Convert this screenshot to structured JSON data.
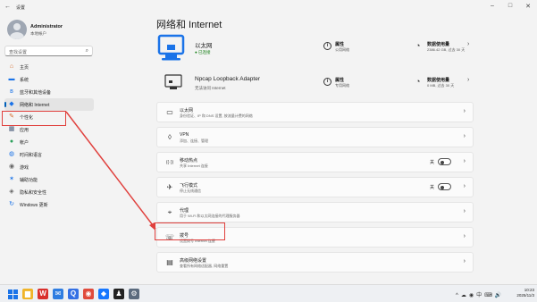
{
  "window": {
    "title": "设置",
    "back": "←",
    "minimize": "–",
    "maximize": "□",
    "close": "✕"
  },
  "profile": {
    "name": "Administrator",
    "account": "本地帐户"
  },
  "search": {
    "placeholder": "查找设置"
  },
  "nav": {
    "items": [
      {
        "label": "主页",
        "icon": "home-icon",
        "glyph": "⌂",
        "color": "#d46a2a"
      },
      {
        "label": "系统",
        "icon": "system-icon",
        "glyph": "▬",
        "color": "#1a73e8"
      },
      {
        "label": "蓝牙和其他设备",
        "icon": "bluetooth-icon",
        "glyph": "ʙ",
        "color": "#1a73e8"
      },
      {
        "label": "网络和 Internet",
        "icon": "wifi-icon",
        "glyph": "◆",
        "color": "#1a73e8"
      },
      {
        "label": "个性化",
        "icon": "brush-icon",
        "glyph": "✎",
        "color": "#d46a2a"
      },
      {
        "label": "应用",
        "icon": "apps-icon",
        "glyph": "▦",
        "color": "#4a5b7a"
      },
      {
        "label": "帐户",
        "icon": "account-icon",
        "glyph": "●",
        "color": "#2aa05a"
      },
      {
        "label": "时间和语言",
        "icon": "globe-icon",
        "glyph": "◍",
        "color": "#1a73e8"
      },
      {
        "label": "游戏",
        "icon": "gamepad-icon",
        "glyph": "◉",
        "color": "#666"
      },
      {
        "label": "辅助功能",
        "icon": "accessibility-icon",
        "glyph": "✶",
        "color": "#1a73e8"
      },
      {
        "label": "隐私和安全性",
        "icon": "shield-icon",
        "glyph": "◈",
        "color": "#666"
      },
      {
        "label": "Windows 更新",
        "icon": "update-icon",
        "glyph": "↻",
        "color": "#1a73e8"
      }
    ],
    "active_index": 3
  },
  "main": {
    "title": "网络和 Internet",
    "adapters": [
      {
        "name": "以太网",
        "status": "已连接",
        "prop_title": "属性",
        "prop_sub": "公用网络",
        "usage_title": "数据使用量",
        "usage_sub": "2386.42 GB, 过去 30 天"
      },
      {
        "name": "Npcap Loopback Adapter",
        "status": "无法访问 Internet",
        "prop_title": "属性",
        "prop_sub": "专用网络",
        "usage_title": "数据使用量",
        "usage_sub": "0 MB, 过去 30 天"
      }
    ],
    "cards": [
      {
        "title": "以太网",
        "sub": "身份验证、IP 和 DNS 设置, 按流量计费的网络",
        "icon": "ethernet-icon",
        "glyph": "▭"
      },
      {
        "title": "VPN",
        "sub": "添加、连接、管理",
        "icon": "vpn-icon",
        "glyph": "◊"
      },
      {
        "title": "移动热点",
        "sub": "共享 Internet 连接",
        "icon": "hotspot-icon",
        "glyph": "((·))",
        "toggle": "关"
      },
      {
        "title": "飞行模式",
        "sub": "停止无线通信",
        "icon": "airplane-icon",
        "glyph": "✈",
        "toggle": "关"
      },
      {
        "title": "代理",
        "sub": "用于 Wi-Fi 和以太网连接的代理服务器",
        "icon": "proxy-icon",
        "glyph": "⌖"
      },
      {
        "title": "拨号",
        "sub": "设置拨号 Internet 连接",
        "icon": "dialup-icon",
        "glyph": "☏"
      },
      {
        "title": "高级网络设置",
        "sub": "查看所有网络适配器, 网络重置",
        "icon": "server-icon",
        "glyph": "▤"
      }
    ]
  },
  "taskbar": {
    "time": "10:23",
    "date": "2025/11/3",
    "tray_symbols": [
      "^",
      "☁",
      "◉",
      "中",
      "⌨",
      "🔊"
    ],
    "apps": [
      {
        "icon": "start-icon"
      },
      {
        "icon": "explorer-icon",
        "glyph": "▆",
        "color": "#f0b429"
      },
      {
        "icon": "wps-icon",
        "glyph": "W",
        "color": "#d9302c"
      },
      {
        "icon": "wechat-work-icon",
        "glyph": "✉",
        "color": "#2f7de1"
      },
      {
        "icon": "qq-browser-icon",
        "glyph": "Q",
        "color": "#3470e4"
      },
      {
        "icon": "chrome-icon",
        "glyph": "◉",
        "color": "#e04b3c"
      },
      {
        "icon": "dingtalk-icon",
        "glyph": "◆",
        "color": "#1677ff"
      },
      {
        "icon": "qq-icon",
        "glyph": "♟",
        "color": "#222"
      },
      {
        "icon": "settings-icon",
        "glyph": "⚙",
        "color": "#5b6b7e"
      }
    ]
  }
}
